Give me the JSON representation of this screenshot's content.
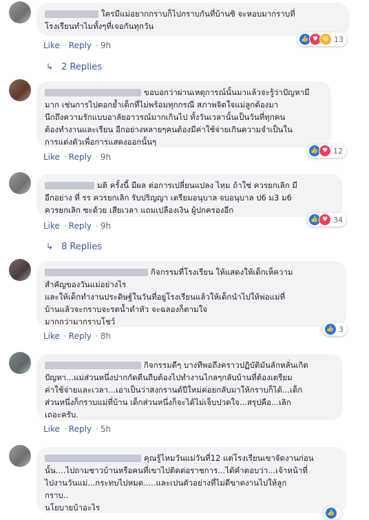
{
  "actions": {
    "like": "Like",
    "reply": "Reply"
  },
  "comments": [
    {
      "text": "ใครมีแม่อยากกราบก็ไปกราบกันที่บ้านซิ จะหอบมากราบที่\nโรงเรียนทำไมทั้งๆที่เจอกันทุกวัน",
      "time": "9h",
      "reactions": [
        "like-icon",
        "love-icon",
        "haha-icon"
      ],
      "reaction_count": "13"
    },
    {
      "text": "ขอบอกว่าผ่านเหตุการณ์นั้นมาแล้วจะรู้ว่าปัญหามี\nมาก เช่นการไปตอกย้ำเด็กที่ไม่พร้อมทุกกรณี สภาพจิตใจแม่ลูกต้องมา\nนึกถึงความรักแบบอาลัยอาวรณ์มากเกินไป ทั้งวันเวลานั้นเป็นวันที่ทุกคน\nต้องทำงานและเรียน อีกอย่างหลายๆคนต้องมีค่าใช้จ่ายเกินความจำเป็นใน\nการแต่งตัวเพื่อการแสดงออกนั้นๆ",
      "time": "9h",
      "reactions": [
        "like-icon",
        "love-icon"
      ],
      "reaction_count": "12"
    },
    {
      "text": "มติ ครั้งนี้ มีผล ต่อการเปลี่ยนแปลง ไหม ถ้าใช่ ควรยกเลิก มี\nอีกอย่าง ที่ รร ควรยกเลิก รับปริญญา เตรียมอนุบาล จบอนุบาล ป6 ม3 ม6\nควรยกเลิก ซะด้วย เสียเวลา แถมเปลืองเงิน ผู้ปกครองอีก",
      "time": "9h",
      "reactions": [
        "like-icon",
        "love-icon"
      ],
      "reaction_count": "34"
    },
    {
      "text": "กิจกรรมที่โรงเรียน ให้แสดงให้เด็กเห็ความ\nสำคัญของวันแม่อย่างไร\nและให้เด็กทำงานประดิษฐ์ในวันที่อยู่โรงเรียนแล้วให้เด็กนำไปให้พ่อแม่ที่\nบ้านแล้วจะกราบจะรดน้ำดำหัว จะฉลองก็ตามใจ\nมากกว่ามากราบโชว์",
      "time": "8h",
      "reactions": [
        "like-icon"
      ],
      "reaction_count": "3"
    },
    {
      "text": "กิจกรรมดีๆ บางทีพอถึงคราวปฏิบัติมันลักหลั่นเกิด\nปัญหา...แม่ส่วนหนึ่งปากกัดตีนถีบต้องไปทำงานไกลๆกลับบ้านที่ต้องเตรียม\nค่าใช้จ่ายและเวลา...เอาเป็นว่าสงกรานต์ปีใหม่ค่อยกลับมาให้กราบก็ได้...เด็ก\nส่วนหนึ่งก็กราบแม่ที่บ้าน เด็กส่วนหนึ่งก็จะได้ไม่เจ็บปวดใจ...สรุปคือ...เลิก\nเถอะครับ.",
      "time": "5h",
      "reactions": [],
      "reaction_count": ""
    },
    {
      "text": "คุณรู้ไหมวันแม่วันที่12 แต่โรงเรียนเขาจัดงานก่อน\nนั้น....ไปถามชาวบ้านหรือคนที่เขาไปติดต่อราชการ...ได้คำตอบว่า...เจ้าหน้าที่\nไปงานวันแม่...กระทบไปหมด.....และเปนตัวอย่างที่ไม่ดีขาดงานไปให้ลูก\nกราบ..\nนโยบายบ้าอะไร",
      "time": "",
      "reactions": [
        "like-icon"
      ],
      "reaction_count": ""
    }
  ],
  "reply_threads": [
    {
      "label": "2 Replies"
    },
    {
      "label": "8 Replies"
    }
  ]
}
